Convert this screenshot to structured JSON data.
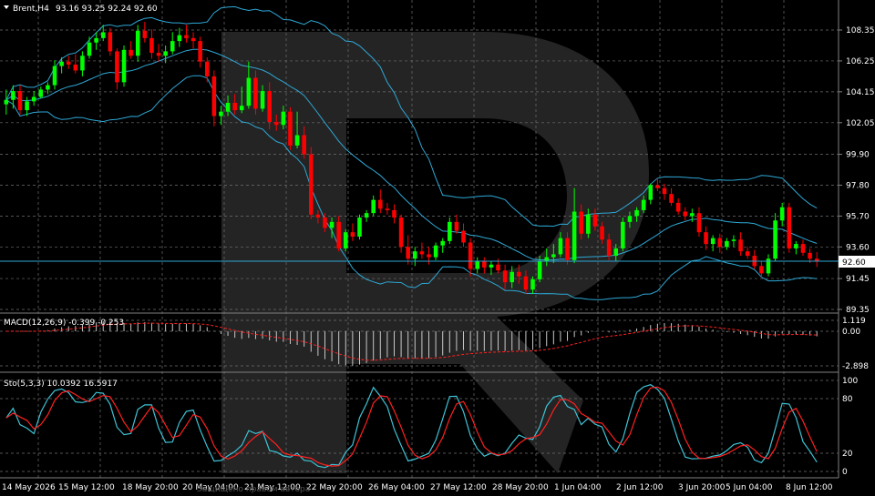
{
  "header": {
    "symbol": "Brent,H4",
    "ohlc": "93.16 93.25 92.24 92.60"
  },
  "watermark": "Защищено правом автора",
  "colors": {
    "background": "#000000",
    "grid": "#6f6f6f",
    "bull": "#00ff00",
    "bear": "#ff0000",
    "bollinger": "#2ea8d6",
    "macd_hist": "#c8c8c8",
    "macd_signal": "#ff2020",
    "stoch_main": "#3ec3d6",
    "stoch_signal": "#ff2020",
    "price_line": "#2ea8d6",
    "current_price_bg": "#ffffff",
    "current_price_fg": "#000000"
  },
  "main": {
    "price_axis": [
      "108.35",
      "106.25",
      "104.15",
      "102.05",
      "99.90",
      "97.80",
      "95.70",
      "93.60",
      "91.45",
      "89.35"
    ],
    "current_price": "92.60"
  },
  "macd": {
    "label": "MACD(12,26,9) -0.399 -0.253",
    "axis": [
      "1.119",
      "0.00",
      "-2.898"
    ]
  },
  "stoch": {
    "label": "Sto(5,3,3) 10.0392 16.5917",
    "axis": [
      "100",
      "80",
      "20",
      "0"
    ]
  },
  "time_axis": [
    "14 May 2026",
    "15 May 12:00",
    "18 May 20:00",
    "20 May 04:00",
    "21 May 12:00",
    "22 May 20:00",
    "26 May 04:00",
    "27 May 12:00",
    "28 May 20:00",
    "1 Jun 04:00",
    "2 Jun 12:00",
    "3 Jun 20:00",
    "5 Jun 04:00",
    "8 Jun 12:00"
  ],
  "chart_data": {
    "type": "candlestick",
    "panes": [
      "price",
      "macd",
      "stochastic"
    ],
    "ylim": [
      89.35,
      109.3
    ],
    "candles": [
      [
        103.3,
        104.3,
        102.6,
        103.6
      ],
      [
        103.6,
        104.6,
        103.0,
        104.2
      ],
      [
        104.2,
        104.6,
        102.6,
        102.9
      ],
      [
        102.9,
        103.8,
        102.5,
        103.5
      ],
      [
        103.5,
        104.2,
        103.2,
        103.8
      ],
      [
        103.8,
        104.5,
        103.7,
        104.3
      ],
      [
        104.3,
        104.8,
        104.0,
        104.6
      ],
      [
        104.6,
        106.3,
        104.3,
        105.9
      ],
      [
        105.9,
        106.5,
        105.4,
        106.2
      ],
      [
        106.2,
        106.6,
        105.7,
        106.0
      ],
      [
        106.0,
        106.7,
        105.4,
        105.6
      ],
      [
        105.6,
        106.9,
        105.2,
        106.6
      ],
      [
        106.6,
        107.9,
        106.4,
        107.5
      ],
      [
        107.5,
        108.2,
        107.0,
        107.8
      ],
      [
        107.8,
        108.7,
        107.6,
        108.2
      ],
      [
        108.2,
        108.5,
        106.6,
        106.9
      ],
      [
        106.9,
        107.1,
        104.3,
        104.8
      ],
      [
        104.8,
        107.3,
        104.5,
        107.0
      ],
      [
        107.0,
        107.6,
        106.4,
        106.6
      ],
      [
        106.6,
        108.7,
        106.2,
        108.3
      ],
      [
        108.3,
        108.9,
        107.5,
        107.8
      ],
      [
        107.8,
        108.4,
        106.4,
        106.8
      ],
      [
        106.8,
        107.4,
        106.2,
        106.6
      ],
      [
        106.6,
        107.3,
        106.1,
        106.9
      ],
      [
        106.9,
        108.2,
        106.7,
        107.6
      ],
      [
        107.6,
        108.5,
        107.2,
        108.0
      ],
      [
        108.0,
        108.7,
        107.5,
        107.8
      ],
      [
        107.8,
        108.2,
        107.1,
        107.6
      ],
      [
        107.6,
        107.9,
        105.8,
        106.2
      ],
      [
        106.2,
        106.5,
        104.8,
        105.2
      ],
      [
        105.2,
        105.6,
        101.8,
        102.5
      ],
      [
        102.5,
        103.2,
        101.9,
        102.8
      ],
      [
        102.8,
        103.9,
        102.5,
        103.4
      ],
      [
        103.4,
        104.0,
        102.6,
        102.9
      ],
      [
        102.9,
        104.5,
        102.7,
        103.2
      ],
      [
        103.2,
        106.2,
        103.0,
        105.1
      ],
      [
        105.1,
        105.6,
        102.6,
        103.0
      ],
      [
        103.0,
        104.6,
        102.8,
        104.2
      ],
      [
        104.2,
        104.8,
        101.6,
        102.1
      ],
      [
        102.1,
        102.6,
        101.5,
        101.9
      ],
      [
        101.9,
        103.2,
        101.6,
        102.8
      ],
      [
        102.8,
        103.1,
        100.2,
        100.5
      ],
      [
        100.5,
        102.8,
        100.3,
        101.2
      ],
      [
        101.2,
        101.8,
        99.6,
        99.9
      ],
      [
        99.9,
        100.4,
        95.5,
        95.8
      ],
      [
        95.8,
        96.1,
        95.2,
        95.6
      ],
      [
        95.6,
        95.9,
        94.6,
        94.9
      ],
      [
        94.9,
        95.6,
        94.2,
        95.3
      ],
      [
        95.3,
        95.7,
        93.3,
        93.5
      ],
      [
        93.5,
        94.8,
        93.3,
        94.6
      ],
      [
        94.6,
        95.2,
        94.0,
        94.3
      ],
      [
        94.3,
        95.8,
        94.1,
        95.6
      ],
      [
        95.6,
        96.1,
        95.3,
        95.9
      ],
      [
        95.9,
        97.1,
        95.7,
        96.8
      ],
      [
        96.8,
        97.5,
        95.9,
        96.2
      ],
      [
        96.2,
        96.6,
        95.8,
        96.1
      ],
      [
        96.1,
        96.5,
        95.2,
        95.6
      ],
      [
        95.6,
        95.8,
        93.2,
        93.6
      ],
      [
        93.6,
        94.4,
        92.4,
        92.8
      ],
      [
        92.8,
        93.6,
        92.3,
        93.3
      ],
      [
        93.3,
        93.9,
        92.8,
        93.1
      ],
      [
        93.1,
        93.6,
        92.4,
        92.9
      ],
      [
        92.9,
        93.9,
        92.7,
        93.7
      ],
      [
        93.7,
        94.2,
        93.2,
        94.0
      ],
      [
        94.0,
        95.6,
        93.8,
        95.3
      ],
      [
        95.3,
        95.8,
        94.5,
        94.7
      ],
      [
        94.7,
        95.2,
        93.6,
        93.9
      ],
      [
        93.9,
        94.2,
        91.6,
        92.1
      ],
      [
        92.1,
        92.9,
        91.8,
        92.6
      ],
      [
        92.6,
        92.9,
        91.8,
        92.2
      ],
      [
        92.2,
        92.6,
        91.7,
        92.4
      ],
      [
        92.4,
        92.8,
        91.8,
        92.0
      ],
      [
        92.0,
        92.4,
        90.7,
        91.2
      ],
      [
        91.2,
        92.3,
        90.8,
        91.9
      ],
      [
        91.9,
        92.4,
        91.1,
        91.6
      ],
      [
        91.6,
        92.0,
        90.4,
        90.7
      ],
      [
        90.7,
        91.6,
        90.4,
        91.4
      ],
      [
        91.4,
        93.0,
        91.2,
        92.6
      ],
      [
        92.6,
        93.5,
        92.3,
        92.9
      ],
      [
        92.9,
        93.8,
        92.5,
        93.1
      ],
      [
        93.1,
        94.6,
        92.9,
        94.2
      ],
      [
        94.2,
        94.6,
        92.4,
        92.7
      ],
      [
        92.7,
        97.6,
        92.5,
        96.0
      ],
      [
        96.0,
        96.5,
        94.1,
        94.5
      ],
      [
        94.5,
        96.2,
        94.2,
        95.8
      ],
      [
        95.8,
        96.2,
        94.7,
        95.0
      ],
      [
        95.0,
        95.3,
        93.8,
        94.1
      ],
      [
        94.1,
        94.5,
        92.7,
        93.0
      ],
      [
        93.0,
        93.8,
        92.6,
        93.5
      ],
      [
        93.5,
        95.6,
        93.3,
        95.3
      ],
      [
        95.3,
        96.0,
        94.9,
        95.7
      ],
      [
        95.7,
        96.3,
        95.3,
        96.1
      ],
      [
        96.1,
        97.1,
        95.9,
        96.8
      ],
      [
        96.8,
        97.9,
        96.5,
        97.8
      ],
      [
        97.8,
        98.3,
        97.4,
        97.6
      ],
      [
        97.6,
        97.9,
        96.8,
        97.2
      ],
      [
        97.2,
        97.6,
        96.4,
        96.6
      ],
      [
        96.6,
        96.9,
        95.8,
        96.0
      ],
      [
        96.0,
        96.3,
        95.4,
        95.7
      ],
      [
        95.7,
        96.2,
        95.3,
        95.9
      ],
      [
        95.9,
        96.3,
        94.3,
        94.6
      ],
      [
        94.6,
        95.0,
        93.4,
        93.8
      ],
      [
        93.8,
        94.4,
        93.3,
        94.2
      ],
      [
        94.2,
        94.5,
        93.2,
        93.6
      ],
      [
        93.6,
        94.2,
        93.4,
        94.0
      ],
      [
        94.0,
        94.4,
        93.6,
        94.1
      ],
      [
        94.1,
        94.6,
        93.0,
        93.3
      ],
      [
        93.3,
        93.6,
        92.8,
        93.0
      ],
      [
        93.0,
        93.4,
        92.1,
        92.3
      ],
      [
        92.3,
        92.6,
        91.5,
        91.8
      ],
      [
        91.8,
        93.1,
        91.6,
        92.8
      ],
      [
        92.8,
        95.9,
        92.6,
        95.4
      ],
      [
        95.4,
        96.6,
        95.0,
        96.3
      ],
      [
        96.3,
        96.6,
        93.2,
        93.5
      ],
      [
        93.5,
        94.0,
        93.1,
        93.8
      ],
      [
        93.8,
        94.1,
        93.0,
        93.2
      ],
      [
        93.2,
        93.5,
        92.5,
        92.8
      ],
      [
        92.8,
        93.25,
        92.24,
        92.6
      ]
    ]
  }
}
